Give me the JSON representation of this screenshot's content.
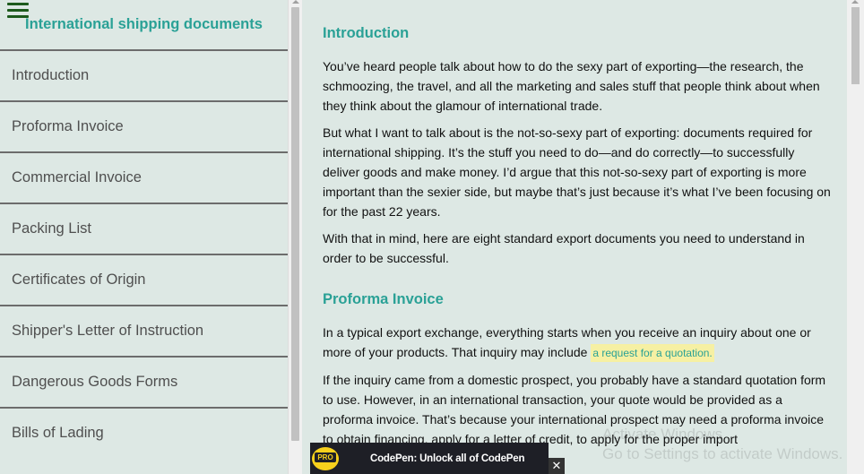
{
  "sidebar": {
    "title": "International shipping documents",
    "items": [
      {
        "label": "Introduction"
      },
      {
        "label": "Proforma Invoice"
      },
      {
        "label": "Commercial Invoice"
      },
      {
        "label": "Packing List"
      },
      {
        "label": "Certificates of Origin"
      },
      {
        "label": "Shipper's Letter of Instruction"
      },
      {
        "label": "Dangerous Goods Forms"
      },
      {
        "label": "Bills of Lading"
      }
    ]
  },
  "main": {
    "intro_heading": "Introduction",
    "intro_p1": "You’ve heard people talk about how to do the sexy part of exporting—the research, the schmoozing, the travel, and all the marketing and sales stuff that people think about when they think about the glamour of international trade.",
    "intro_p2": "But what I want to talk about is the not-so-sexy part of exporting: documents required for international shipping. It’s the stuff you need to do—and do correctly—to successfully deliver goods and make money. I’d argue that this not-so-sexy part of exporting is more important than the sexier side, but maybe that’s just because it’s what I’ve been focusing on for the past 22 years.",
    "intro_p3": "With that in mind, here are eight standard export documents you need to understand in order to be successful.",
    "proforma_heading": "Proforma Invoice",
    "proforma_p1_text": "In a typical export exchange, everything starts when you receive an inquiry about one or more of your products. That inquiry may include ",
    "proforma_p1_link": "a request for a quotation.",
    "proforma_p2": "If the inquiry came from a domestic prospect, you probably have a standard quotation form to use. However, in an international transaction, your quote would be provided as a proforma invoice. That’s because your international prospect may need a proforma invoice to obtain financing, apply for a letter of credit, to apply for the proper import"
  },
  "promo": {
    "badge": "PRO",
    "text": "CodePen: Unlock all of CodePen",
    "close": "✕"
  },
  "watermark": {
    "line1": "Activate Windows",
    "line2": "Go to Settings to activate Windows."
  }
}
